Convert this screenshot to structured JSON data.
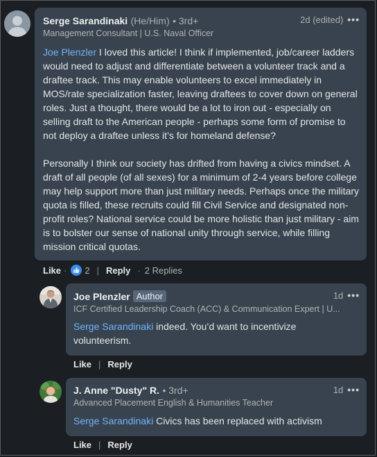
{
  "comment": {
    "author": "Serge Sarandinaki",
    "pronouns": "(He/Him)",
    "degree": "• 3rd+",
    "headline": "Management Consultant | U.S. Naval Officer",
    "time": "2d (edited)",
    "mention": "Joe Plenzler",
    "text_p1": " I loved this article! I think if implemented, job/career ladders would need to adjust and differentiate between a volunteer track and a draftee track. This may enable volunteers to excel immediately in MOS/rate specialization faster, leaving draftees to cover down on general roles. Just a thought, there would be a lot to iron out - especially on selling draft to the American people - perhaps some form of promise to not deploy a draftee unless it’s for homeland defense?",
    "text_p2": "Personally I think our society has drifted from having a civics mindset. A draft of all people (of all sexes) for a minimum of 2-4 years before college may help support more than just military needs. Perhaps once the military quota is filled, these recruits could fill Civil Service and designated non-profit roles? National service could be more holistic than just military - aim is to bolster our sense of national unity through service, while filling mission critical quotas.",
    "like_label": "Like",
    "reaction_count": "2",
    "reply_label": "Reply",
    "replies_label": "2 Replies"
  },
  "replies": [
    {
      "author": "Joe Plenzler",
      "badge": "Author",
      "headline": "ICF Certified Leadership Coach (ACC) & Communication Expert | U...",
      "time": "1d",
      "mention": "Serge Sarandinaki",
      "text": " indeed. You’d want to incentivize volunteerism.",
      "like_label": "Like",
      "reply_label": "Reply"
    },
    {
      "author": "J. Anne \"Dusty\" R.",
      "degree": "• 3rd+",
      "headline": "Advanced Placement English & Humanities Teacher",
      "time": "1d",
      "mention": "Serge Sarandinaki",
      "text": " Civics has been replaced with activism",
      "like_label": "Like",
      "reply_label": "Reply"
    }
  ],
  "icons": {
    "more": "more-horizontal-icon",
    "like_reaction": "thumbs-up-icon"
  },
  "colors": {
    "background": "#1b1f23",
    "bubble": "#38434f",
    "link": "#70b5f9",
    "reaction": "#378fe9"
  }
}
